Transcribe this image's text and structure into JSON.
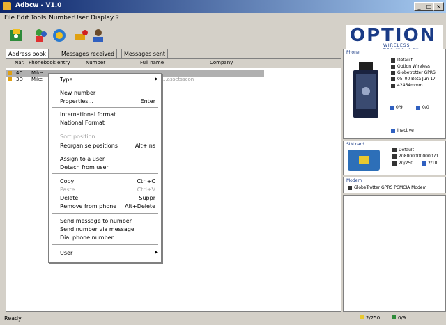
{
  "window": {
    "title": "Adbcw - V1.0"
  },
  "menubar": [
    "File",
    "Edit",
    "Tools",
    "Number",
    "User",
    "Display",
    "?"
  ],
  "logo": {
    "text": "OPTION",
    "sub": "WIRELESS TECHNOLOGY"
  },
  "tabs": [
    "Address book",
    "Messages received",
    "Messages sent"
  ],
  "columns": [
    "Nar.",
    "Phonebook entry",
    "Number",
    "Full name",
    "Company"
  ],
  "rows": [
    {
      "num": "4C",
      "entry": "Mike",
      "number": "",
      "fullname": "",
      "company": ""
    },
    {
      "num": "3D",
      "entry": "Mike",
      "number": "",
      "fullname": "...assetsscon",
      "company": ""
    }
  ],
  "context_menu": {
    "type": "Type",
    "new_number": "New number",
    "properties": "Properties...",
    "properties_sc": "Enter",
    "international": "International format",
    "national": "National Format",
    "sort_position": "Sort position",
    "reorganise": "Reorganise positions",
    "reorganise_sc": "Alt+Ins",
    "assign": "Assign to a user",
    "detach": "Detach from user",
    "copy": "Copy",
    "copy_sc": "Ctrl+C",
    "paste": "Paste",
    "paste_sc": "Ctrl+V",
    "delete": "Delete",
    "delete_sc": "Suppr",
    "remove": "Remove from phone",
    "remove_sc": "Alt+Delete",
    "send_msg": "Send message to number",
    "send_num": "Send number via message",
    "dial": "Dial phone number",
    "user": "User"
  },
  "phone": {
    "title": "Phone",
    "lines": [
      "Default",
      "Option Wireless",
      "Globetrotter GPRS",
      "05_00 Beta Jun 17",
      "42464mmm"
    ],
    "count1": "0/9",
    "count2": "0/0",
    "status": "Inactive"
  },
  "sim": {
    "title": "SIM card",
    "lines": [
      "Default",
      "208000000000071",
      "20/250"
    ],
    "count": "2/10"
  },
  "modem": {
    "title": "Modem",
    "line": "GlobeTrotter GPRS PCMCIA Modem"
  },
  "status": {
    "left": "Ready",
    "count1": "2/250",
    "count2": "0/9"
  }
}
